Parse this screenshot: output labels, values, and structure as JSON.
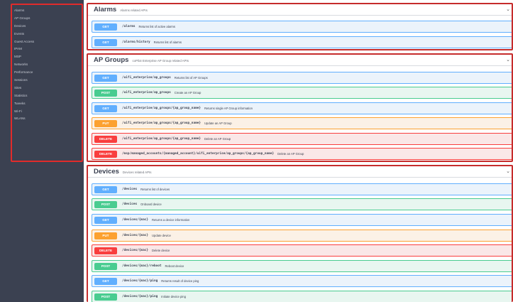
{
  "sidebar": {
    "items": [
      "Alarms",
      "AP Groups",
      "Devices",
      "Events",
      "Guest Access",
      "IPAM",
      "MSP",
      "Networks",
      "Performance",
      "Sessions",
      "Sites",
      "Statistics",
      "Tweeks",
      "Wi-Fi",
      "WLANs"
    ]
  },
  "sections": [
    {
      "title": "Alarms",
      "description": "Alarms related APIs",
      "operations": [
        {
          "method": "GET",
          "path": "/alarms",
          "summary": "Returns list of active alarms"
        },
        {
          "method": "GET",
          "path": "/alarms/history",
          "summary": "Returns list of alarms"
        }
      ]
    },
    {
      "title": "AP Groups",
      "description": "coPilot Enterprise AP Group related APIs",
      "operations": [
        {
          "method": "GET",
          "path": "/uifi_enterprise/ap_groups",
          "summary": "Returns list of AP Groups"
        },
        {
          "method": "POST",
          "path": "/uifi_enterprise/ap_groups",
          "summary": "Create an AP Group"
        },
        {
          "method": "GET",
          "path": "/uifi_enterprise/ap_groups/{ap_group_name}",
          "summary": "Returns single AP Group information"
        },
        {
          "method": "PUT",
          "path": "/uifi_enterprise/ap_groups/{ap_group_name}",
          "summary": "Update an AP Group"
        },
        {
          "method": "DELETE",
          "path": "/uifi_enterprise/ap_groups/{ap_group_name}",
          "summary": "Delete an AP Group"
        },
        {
          "method": "DELETE",
          "path": "/msp/managed_accounts/{managed_account}/uifi_enterprise/ap_groups/{ap_group_name}",
          "summary": "Delete an AP Group"
        }
      ]
    },
    {
      "title": "Devices",
      "description": "Devices related APIs",
      "operations": [
        {
          "method": "GET",
          "path": "/devices",
          "summary": "Returns list of devices"
        },
        {
          "method": "POST",
          "path": "/devices",
          "summary": "Onboard device"
        },
        {
          "method": "GET",
          "path": "/devices/{mac}",
          "summary": "Returns a device information"
        },
        {
          "method": "PUT",
          "path": "/devices/{mac}",
          "summary": "Update device"
        },
        {
          "method": "DELETE",
          "path": "/devices/{mac}",
          "summary": "Delete device"
        },
        {
          "method": "POST",
          "path": "/devices/{mac}/reboot",
          "summary": "Reboot device"
        },
        {
          "method": "GET",
          "path": "/devices/{mac}/ping",
          "summary": "Returns result of device ping"
        },
        {
          "method": "POST",
          "path": "/devices/{mac}/ping",
          "summary": "Initiate device ping"
        }
      ]
    }
  ],
  "icons": {
    "collapse": "chevron-down-icon"
  },
  "colors": {
    "get": "#61affe",
    "post": "#49cc90",
    "put": "#fca130",
    "delete": "#f93e3e",
    "sidebar_bg": "#3b4151",
    "highlight": "#e12b2b"
  }
}
